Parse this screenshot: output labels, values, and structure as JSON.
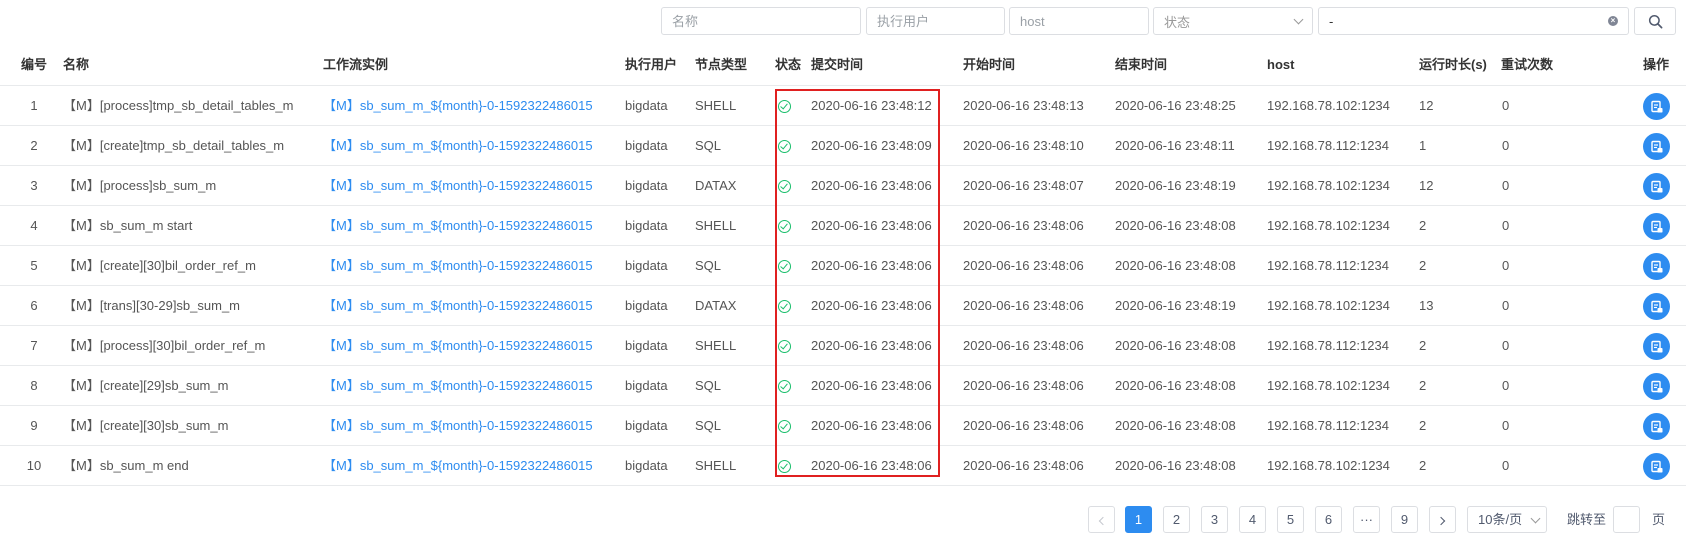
{
  "filters": {
    "name_placeholder": "名称",
    "user_placeholder": "执行用户",
    "host_placeholder": "host",
    "status_placeholder": "状态",
    "date_range_separator": "-"
  },
  "table": {
    "headers": [
      "编号",
      "名称",
      "工作流实例",
      "执行用户",
      "节点类型",
      "状态",
      "提交时间",
      "开始时间",
      "结束时间",
      "host",
      "运行时长(s)",
      "重试次数",
      "操作"
    ],
    "rows": [
      {
        "id": "1",
        "name": "【M】[process]tmp_sb_detail_tables_m",
        "workflow": "【M】sb_sum_m_${month}-0-1592322486015",
        "user": "bigdata",
        "type": "SHELL",
        "submit": "2020-06-16 23:48:12",
        "start": "2020-06-16 23:48:13",
        "end": "2020-06-16 23:48:25",
        "host": "192.168.78.102:1234",
        "duration": "12",
        "retries": "0"
      },
      {
        "id": "2",
        "name": "【M】[create]tmp_sb_detail_tables_m",
        "workflow": "【M】sb_sum_m_${month}-0-1592322486015",
        "user": "bigdata",
        "type": "SQL",
        "submit": "2020-06-16 23:48:09",
        "start": "2020-06-16 23:48:10",
        "end": "2020-06-16 23:48:11",
        "host": "192.168.78.112:1234",
        "duration": "1",
        "retries": "0"
      },
      {
        "id": "3",
        "name": "【M】[process]sb_sum_m",
        "workflow": "【M】sb_sum_m_${month}-0-1592322486015",
        "user": "bigdata",
        "type": "DATAX",
        "submit": "2020-06-16 23:48:06",
        "start": "2020-06-16 23:48:07",
        "end": "2020-06-16 23:48:19",
        "host": "192.168.78.102:1234",
        "duration": "12",
        "retries": "0"
      },
      {
        "id": "4",
        "name": "【M】sb_sum_m start",
        "workflow": "【M】sb_sum_m_${month}-0-1592322486015",
        "user": "bigdata",
        "type": "SHELL",
        "submit": "2020-06-16 23:48:06",
        "start": "2020-06-16 23:48:06",
        "end": "2020-06-16 23:48:08",
        "host": "192.168.78.102:1234",
        "duration": "2",
        "retries": "0"
      },
      {
        "id": "5",
        "name": "【M】[create][30]bil_order_ref_m",
        "workflow": "【M】sb_sum_m_${month}-0-1592322486015",
        "user": "bigdata",
        "type": "SQL",
        "submit": "2020-06-16 23:48:06",
        "start": "2020-06-16 23:48:06",
        "end": "2020-06-16 23:48:08",
        "host": "192.168.78.112:1234",
        "duration": "2",
        "retries": "0"
      },
      {
        "id": "6",
        "name": "【M】[trans][30-29]sb_sum_m",
        "workflow": "【M】sb_sum_m_${month}-0-1592322486015",
        "user": "bigdata",
        "type": "DATAX",
        "submit": "2020-06-16 23:48:06",
        "start": "2020-06-16 23:48:06",
        "end": "2020-06-16 23:48:19",
        "host": "192.168.78.102:1234",
        "duration": "13",
        "retries": "0"
      },
      {
        "id": "7",
        "name": "【M】[process][30]bil_order_ref_m",
        "workflow": "【M】sb_sum_m_${month}-0-1592322486015",
        "user": "bigdata",
        "type": "SHELL",
        "submit": "2020-06-16 23:48:06",
        "start": "2020-06-16 23:48:06",
        "end": "2020-06-16 23:48:08",
        "host": "192.168.78.112:1234",
        "duration": "2",
        "retries": "0"
      },
      {
        "id": "8",
        "name": "【M】[create][29]sb_sum_m",
        "workflow": "【M】sb_sum_m_${month}-0-1592322486015",
        "user": "bigdata",
        "type": "SQL",
        "submit": "2020-06-16 23:48:06",
        "start": "2020-06-16 23:48:06",
        "end": "2020-06-16 23:48:08",
        "host": "192.168.78.102:1234",
        "duration": "2",
        "retries": "0"
      },
      {
        "id": "9",
        "name": "【M】[create][30]sb_sum_m",
        "workflow": "【M】sb_sum_m_${month}-0-1592322486015",
        "user": "bigdata",
        "type": "SQL",
        "submit": "2020-06-16 23:48:06",
        "start": "2020-06-16 23:48:06",
        "end": "2020-06-16 23:48:08",
        "host": "192.168.78.112:1234",
        "duration": "2",
        "retries": "0"
      },
      {
        "id": "10",
        "name": "【M】sb_sum_m end",
        "workflow": "【M】sb_sum_m_${month}-0-1592322486015",
        "user": "bigdata",
        "type": "SHELL",
        "submit": "2020-06-16 23:48:06",
        "start": "2020-06-16 23:48:06",
        "end": "2020-06-16 23:48:08",
        "host": "192.168.78.102:1234",
        "duration": "2",
        "retries": "0"
      }
    ]
  },
  "pagination": {
    "pages": [
      "1",
      "2",
      "3",
      "4",
      "5",
      "6",
      "···",
      "9"
    ],
    "current": "1",
    "page_size": "10条/页",
    "jump_label": "跳转至",
    "page_suffix": "页"
  },
  "colors": {
    "accent": "#2d8cf0",
    "success": "#19be6b",
    "highlight_border": "#e02020"
  }
}
